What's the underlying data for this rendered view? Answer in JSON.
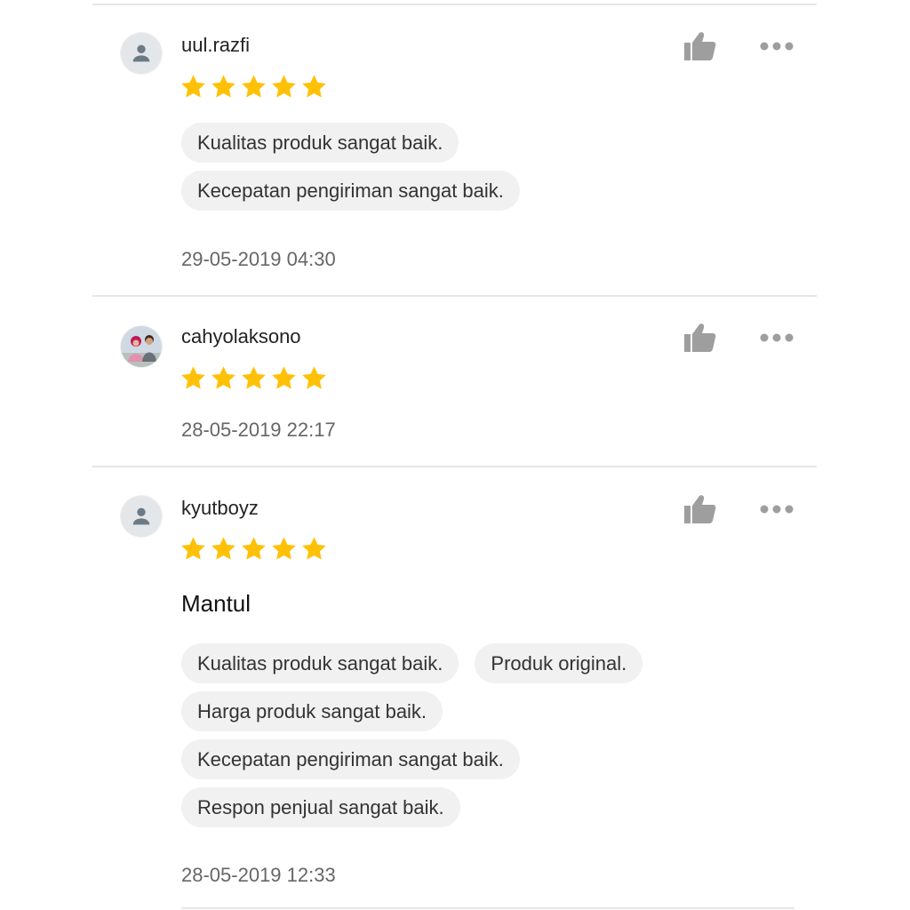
{
  "colors": {
    "star": "#FFC107",
    "icon_gray": "#9E9E9E",
    "chip_bg": "#F1F1F1",
    "divider": "#E6E6E6"
  },
  "icons": {
    "like": "thumbs-up-icon",
    "more": "more-horizontal-icon",
    "star": "star-icon",
    "avatar": "user-icon"
  },
  "reviews": [
    {
      "username": "uul.razfi",
      "rating": 5,
      "chips": [
        "Kualitas produk sangat baik.",
        "Kecepatan pengiriman sangat baik."
      ],
      "date": "29-05-2019 04:30"
    },
    {
      "username": "cahyolaksono",
      "rating": 5,
      "date": "28-05-2019 22:17"
    },
    {
      "username": "kyutboyz",
      "rating": 5,
      "comment": "Mantul",
      "chips": [
        "Kualitas produk sangat baik.",
        "Produk original.",
        "Harga produk sangat baik.",
        "Kecepatan pengiriman sangat baik.",
        "Respon penjual sangat baik."
      ],
      "date": "28-05-2019 12:33"
    }
  ]
}
